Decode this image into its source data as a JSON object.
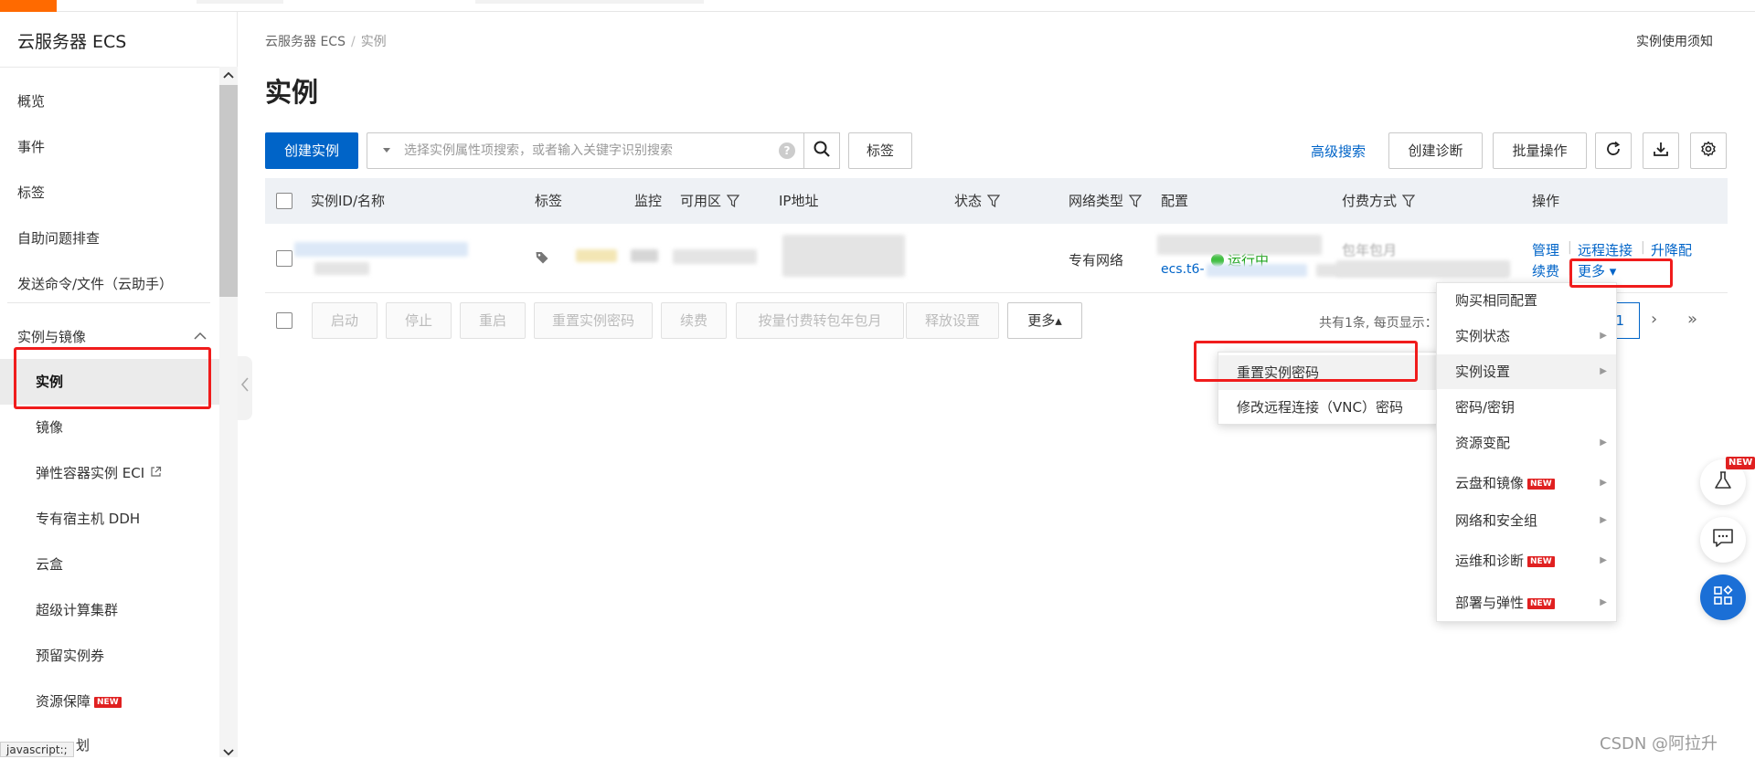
{
  "sidebar": {
    "title": "云服务器 ECS",
    "items": [
      {
        "label": "概览"
      },
      {
        "label": "事件"
      },
      {
        "label": "标签"
      },
      {
        "label": "自助问题排查"
      },
      {
        "label": "发送命令/文件（云助手）"
      }
    ],
    "group": {
      "label": "实例与镜像"
    },
    "sub_items": [
      {
        "label": "实例",
        "active": true
      },
      {
        "label": "镜像"
      },
      {
        "label": "弹性容器实例 ECI"
      },
      {
        "label": "专有宿主机 DDH"
      },
      {
        "label": "云盒"
      },
      {
        "label": "超级计算集群"
      },
      {
        "label": "预留实例券"
      },
      {
        "label": "资源保障",
        "badge": "NEW"
      },
      {
        "label": "划"
      }
    ],
    "status_tip": "javascript:;"
  },
  "breadcrumb": {
    "root": "云服务器 ECS",
    "separator": "/",
    "current": "实例"
  },
  "header": {
    "title": "实例",
    "notice_link": "实例使用须知"
  },
  "toolbar": {
    "create_label": "创建实例",
    "search_placeholder": "选择实例属性项搜索，或者输入关键字识别搜索",
    "help_label": "?",
    "tag_label": "标签",
    "advanced_search": "高级搜索",
    "diagnose_label": "创建诊断",
    "batch_label": "批量操作"
  },
  "table": {
    "columns": [
      "实例ID/名称",
      "标签",
      "监控",
      "可用区",
      "IP地址",
      "状态",
      "网络类型",
      "配置",
      "付费方式",
      "操作"
    ],
    "row": {
      "status": "运行中",
      "network": "专有网络",
      "config_partial": "ecs.t6-",
      "pay_partial": "包年包月",
      "ops": {
        "manage": "管理",
        "remote": "远程连接",
        "upgrade": "升降配",
        "renew": "续费",
        "more": "更多 ▾"
      }
    }
  },
  "footer": {
    "buttons": [
      "启动",
      "停止",
      "重启",
      "重置实例密码",
      "续费",
      "按量付费转包年包月",
      "释放设置",
      "更多▴"
    ],
    "pager_text": "共有1条, 每页显示：",
    "page": "1",
    "next": "›",
    "last": "»"
  },
  "more_menu": {
    "items": [
      {
        "label": "购买相同配置",
        "sub": false,
        "badge": ""
      },
      {
        "label": "实例状态",
        "sub": true,
        "badge": ""
      },
      {
        "label": "实例设置",
        "sub": true,
        "badge": ""
      },
      {
        "label": "密码/密钥",
        "sub": false,
        "badge": ""
      },
      {
        "label": "资源变配",
        "sub": true,
        "badge": ""
      },
      {
        "label": "云盘和镜像",
        "sub": true,
        "badge": "NEW"
      },
      {
        "label": "网络和安全组",
        "sub": true,
        "badge": ""
      },
      {
        "label": "运维和诊断",
        "sub": true,
        "badge": "NEW"
      },
      {
        "label": "部署与弹性",
        "sub": true,
        "badge": "NEW"
      }
    ]
  },
  "password_submenu": {
    "items": [
      {
        "label": "重置实例密码"
      },
      {
        "label": "修改远程连接（VNC）密码"
      }
    ]
  },
  "float_tools": {
    "new_badge": "NEW"
  },
  "watermark": "CSDN @阿拉升",
  "colors": {
    "brand": "#ff6a00",
    "primary": "#0064c8",
    "highlight_box": "#f01c1c",
    "running": "#13a10e"
  }
}
